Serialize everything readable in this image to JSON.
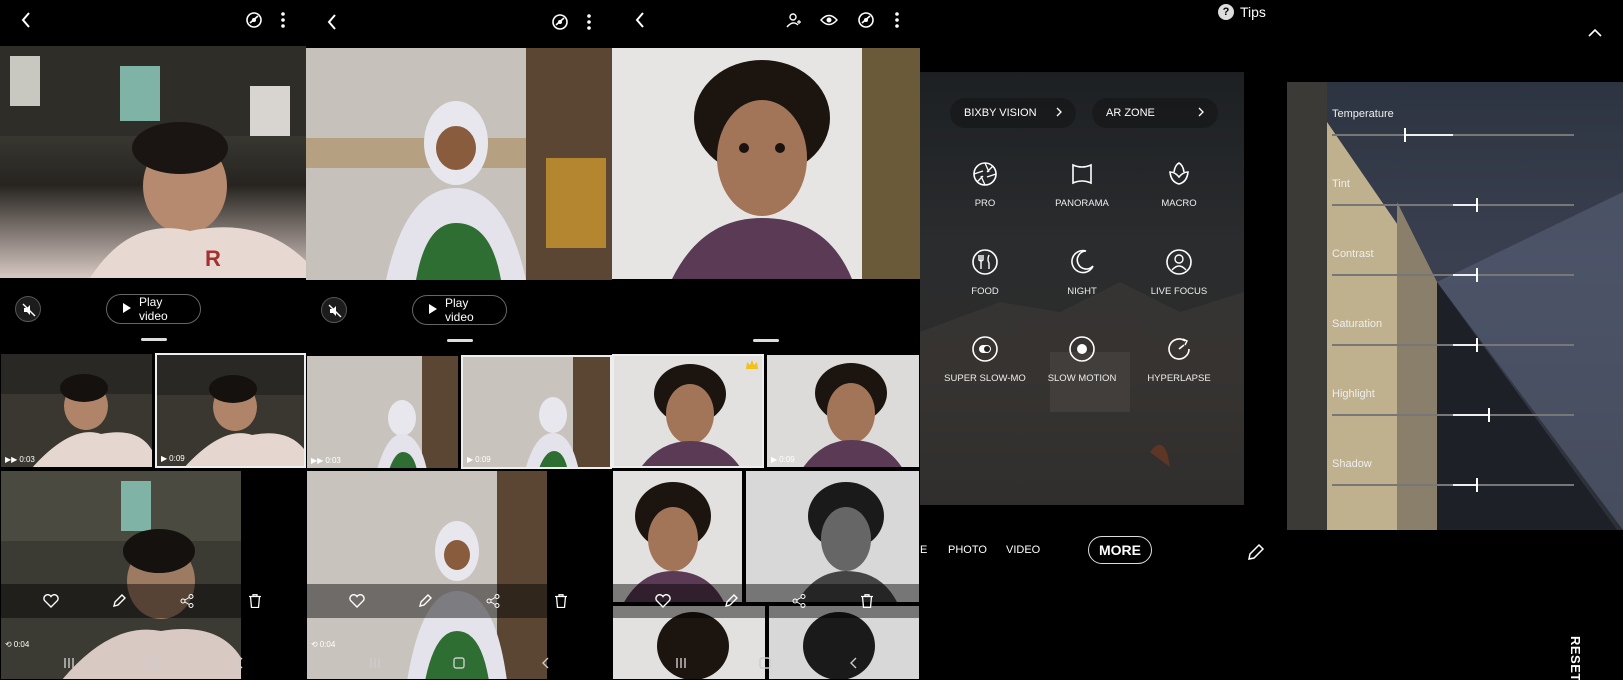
{
  "gallery_panels": [
    {
      "play_label": "Play video",
      "thumb_durations": [
        "0:03",
        "0:09"
      ],
      "bottom_duration": "0:04"
    },
    {
      "play_label": "Play video",
      "thumb_durations": [
        "0:03",
        "0:09"
      ],
      "bottom_duration": "0:04"
    },
    {
      "thumb_durations": [
        "",
        "0:09"
      ]
    }
  ],
  "camera": {
    "tips_label": "Tips",
    "quick": [
      {
        "label": "BIXBY VISION"
      },
      {
        "label": "AR ZONE"
      }
    ],
    "modes": [
      {
        "label": "PRO",
        "icon": "aperture-icon"
      },
      {
        "label": "PANORAMA",
        "icon": "panorama-icon"
      },
      {
        "label": "MACRO",
        "icon": "flower-icon"
      },
      {
        "label": "FOOD",
        "icon": "fork-knife-icon"
      },
      {
        "label": "NIGHT",
        "icon": "moon-icon"
      },
      {
        "label": "LIVE FOCUS",
        "icon": "person-icon"
      },
      {
        "label": "SUPER SLOW-MO",
        "icon": "super-slow-icon"
      },
      {
        "label": "SLOW MOTION",
        "icon": "slow-motion-icon"
      },
      {
        "label": "HYPERLAPSE",
        "icon": "hyperlapse-icon"
      }
    ],
    "mode_bar": {
      "partial": "E",
      "photo": "PHOTO",
      "video": "VIDEO",
      "more": "MORE"
    }
  },
  "adjust": {
    "reset_label": "RESET",
    "sliders": [
      {
        "label": "Temperature",
        "value": 0.3
      },
      {
        "label": "Tint",
        "value": 0.6
      },
      {
        "label": "Contrast",
        "value": 0.6
      },
      {
        "label": "Saturation",
        "value": 0.6
      },
      {
        "label": "Highlight",
        "value": 0.65
      },
      {
        "label": "Shadow",
        "value": 0.6
      }
    ]
  },
  "colors": {
    "background": "#000000",
    "accent_white": "#ffffff"
  }
}
